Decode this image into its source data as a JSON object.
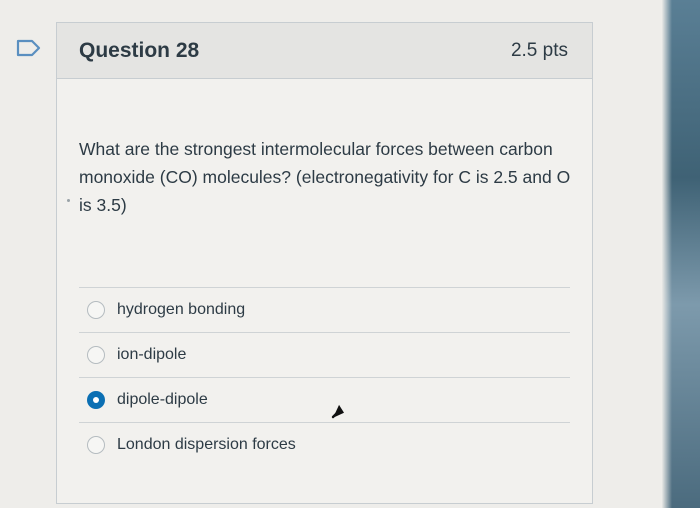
{
  "question": {
    "title": "Question 28",
    "points": "2.5 pts",
    "text": "What are the strongest intermolecular forces between carbon monoxide (CO) molecules? (electronegativity for C is 2.5 and O is 3.5)"
  },
  "answers": [
    {
      "label": "hydrogen bonding",
      "selected": false
    },
    {
      "label": "ion-dipole",
      "selected": false
    },
    {
      "label": "dipole-dipole",
      "selected": true
    },
    {
      "label": "London dispersion forces",
      "selected": false
    }
  ],
  "colors": {
    "accent": "#0b6fb3",
    "header_bg": "#e4e4e2",
    "text": "#2d3b45"
  },
  "icons": {
    "flag": "bookmark-flag-icon",
    "cursor": "mouse-pointer-icon"
  }
}
